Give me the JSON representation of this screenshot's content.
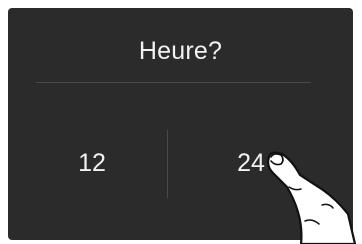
{
  "dialog": {
    "title": "Heure?",
    "options": [
      {
        "label": "12"
      },
      {
        "label": "24"
      }
    ],
    "selected": "24"
  },
  "icons": {
    "pointer": "hand-pointer-icon"
  },
  "colors": {
    "screen_bg": "#2b2b2b",
    "text": "#f2f2f2",
    "divider": "#4a4a4a"
  }
}
